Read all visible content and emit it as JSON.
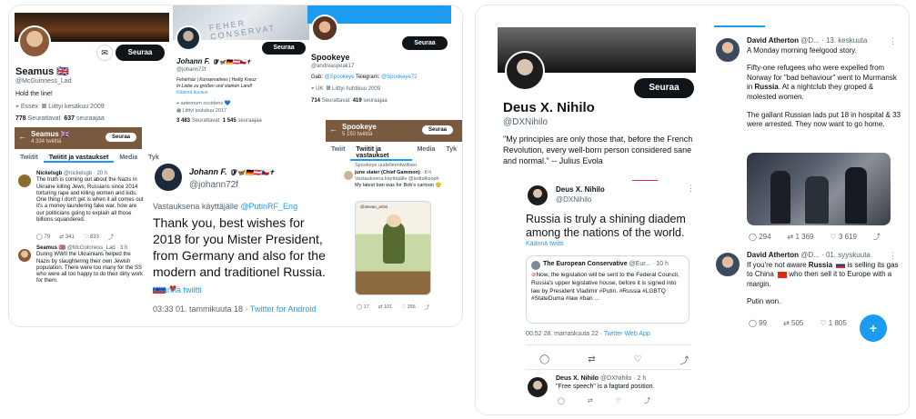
{
  "p1": {
    "follow": "Seuraa",
    "name": "Seamus 🇬🇧",
    "handle": "@McGuinness_Lad",
    "bio": "Hold the line!",
    "location": "Essex",
    "joined": "Liittyi kesäkuu 2009",
    "following_n": "778",
    "following_l": "Seurattavat",
    "followers_n": "637",
    "followers_l": "seuraajaa",
    "sub_name": "Seamus 🇬🇧",
    "sub_count": "4 334 twiittiä",
    "sub_follow": "Seuraa",
    "tabs": [
      "Twiitit",
      "Twiitit ja vastaukset",
      "Media",
      "Tyk"
    ],
    "t1_name": "Nickelsgb",
    "t1_meta": "@nickelsgb · 20 h",
    "t1_text": "The truth is coming out about the Nazis in Ukraine killing Jews, Russians since 2014 torturing rape and killing women and kids. One thing I don't get is when it all comes out it's a money laundering fake war, how are our politicians going to explain all those billions squandered.",
    "t1_stats": [
      "79",
      "341",
      "833"
    ],
    "t2_name": "Seamus 🇬🇧",
    "t2_meta": "@McGuinness_Lad · 3 h",
    "t2_text": "During WWII the Ukrainians helped the Nazis by slaughtering their own Jewish population. There were too many for the SS who were all too happy to do their dirty work for them."
  },
  "p2": {
    "banner_text": "FEHER CONSERVAT",
    "follow": "Seuraa",
    "name": "Johann F.",
    "handle": "@johann72f",
    "bio1": "Fehérház | Konservatives | Heilig Kreuz",
    "bio2": "In Liebe zu großen und starken Land!",
    "bio3": "Käännä kuvaus",
    "location": "aeternum occidens",
    "joined": "Liittyi joulukuu 2017",
    "following_n": "3 483",
    "following_l": "Seurattavat",
    "followers_n": "1 545",
    "followers_l": "seuraajaa"
  },
  "p3": {
    "follow": "Seuraa",
    "name": "Spookeye",
    "handle": "@andreaspeak17",
    "bio_pre": "Gab:",
    "bio_gab": "@Spookeye",
    "bio_mid": "Telegram:",
    "bio_tg": "@Spookeye72",
    "location": "UK",
    "joined": "Liittyi huhtikuu 2009",
    "following_n": "714",
    "following_l": "Seurattavat",
    "followers_n": "419",
    "followers_l": "seuraajaa"
  },
  "p4": {
    "name": "Spookeye",
    "count": "5 150 twiittiä",
    "follow": "Seuraa",
    "tabs": [
      "Twiit",
      "Twiitit ja vastaukset",
      "Media",
      "Tyk"
    ],
    "note": "Spookeye uudelleentwiittasi",
    "t_name": "june slater (Chief Gammon)",
    "t_meta": "· 8 h",
    "t_reply": "Vastauksena käyttäjälle @tedtalksoph",
    "t_text": "My latest ban was for Bob's cartoon 🙂",
    "cartoon_credit": "@stevan_artist",
    "stats": [
      "17",
      "101",
      "356"
    ]
  },
  "p5": {
    "name": "Johann F.",
    "handle": "@johann72f",
    "reply_pre": "Vastauksena käyttäjälle",
    "reply_handle": "@PutinRF_Eng",
    "text": "Thank you, best wishes for 2018 for you Mister President, from Germany and also for the modern and traditionel Russia.",
    "translate": "Käännä twiitti",
    "meta": "03:33 01. tammikuuta 18 ·",
    "source": "Twitter for Android"
  },
  "p6": {
    "follow": "Seuraa",
    "name": "Deus X. Nihilo",
    "handle": "@DXNihilo",
    "quote": "\"My principles are only those that, before the French Revolution, every well-born person considered sane and normal.\" -- Julius Evola",
    "t_name": "Deus X. Nihilo",
    "t_handle": "@DXNihilo",
    "t_text": "Russia is truly a shining diadem among the nations of the world.",
    "translate": "Käännä twiitti",
    "q_name": "The European Conservative",
    "q_meta": "@Eur... · 10 h",
    "q_text": "Now, the legislation will be sent to the Federal Council, Russia's upper legislative house, before it is signed into law by President Vladimir #Putin. #Russia #LGBTQ #StateDuma #law #ban ...",
    "meta": "00:52 28. marraskuuta 22 ·",
    "source": "Twitter Web App",
    "r_name": "Deus X. Nihilo",
    "r_meta": "@DXNihilo · 2 h",
    "r_text": "\"Free speech\" is a fagtard position."
  },
  "p7": {
    "t1_name": "David Atherton",
    "t1_meta": "@D... · 13. keskuuta",
    "t1_line1": "A Monday morning feelgood story.",
    "t1_p2a": "Fifty-one refugees who were expelled from Norway for \"bad behaviour\" went to Murmansk in",
    "t1_russia": "Russia",
    "t1_p2b": ". At a nightclub they groped & molested women.",
    "t1_p3": "The gallant Russian lads put 18 in hospital & 33 were arrested. They now want to go home.",
    "t1_stats": [
      "294",
      "1 369",
      "3 619"
    ],
    "t2_name": "David Atherton",
    "t2_meta": "@D... · 01. syyskuuta",
    "t2_a": "If you're not aware",
    "t2_russia": "Russia",
    "t2_b": "is selling its gas to China",
    "t2_c": "who then sell it to Europe with a margin.",
    "t2_d": "Putin won.",
    "t2_stats": [
      "99",
      "505",
      "1 805"
    ]
  }
}
